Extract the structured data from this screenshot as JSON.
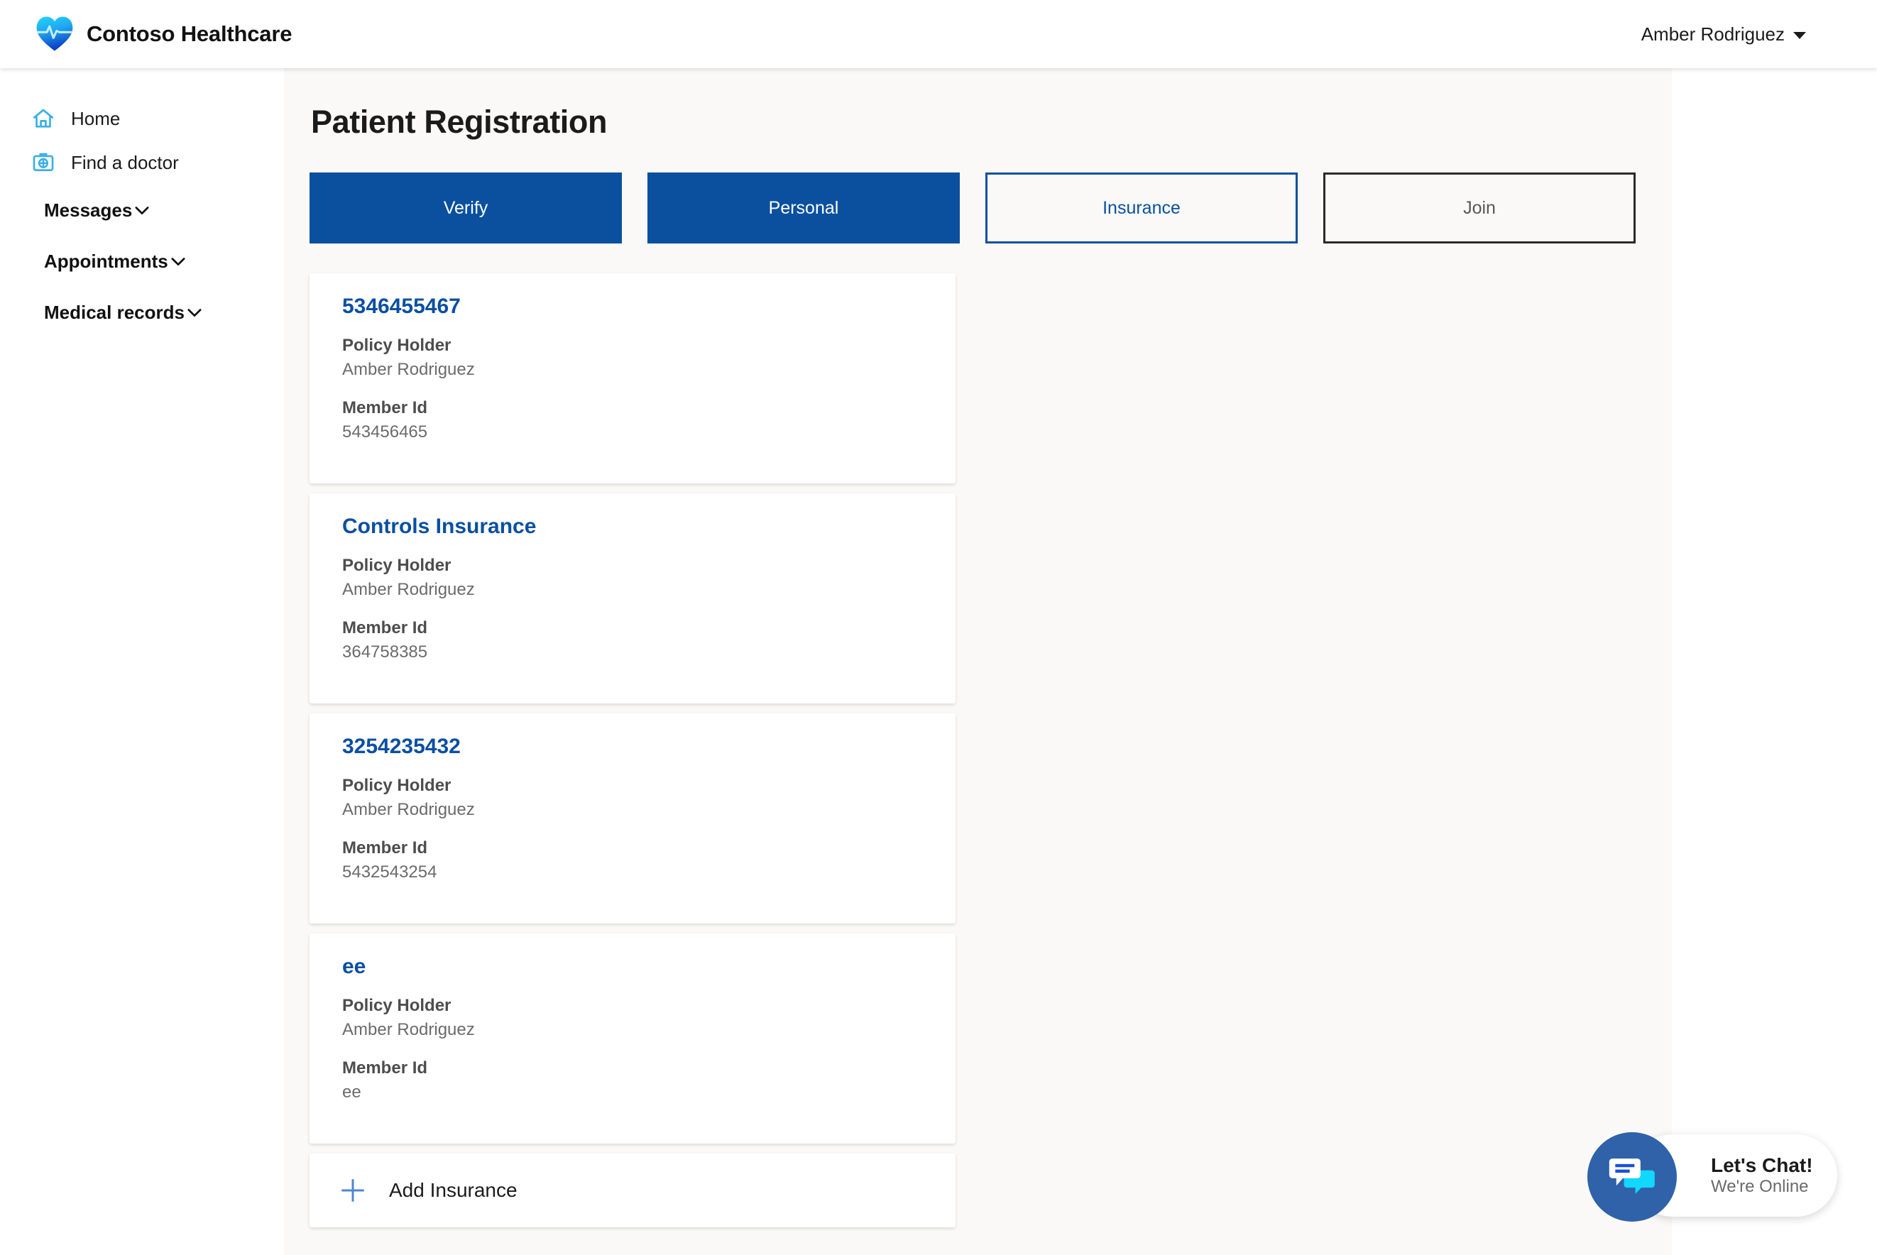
{
  "header": {
    "brand_name": "Contoso Healthcare",
    "logo_icon": "heart-pulse-logo",
    "account_name": "Amber Rodriguez",
    "account_caret_icon": "caret-down-icon"
  },
  "sidebar": {
    "links": [
      {
        "label": "Home",
        "icon": "home-icon"
      },
      {
        "label": "Find a doctor",
        "icon": "first-aid-kit-icon"
      }
    ],
    "sections": [
      {
        "label": "Messages",
        "icon": "chevron-down-icon"
      },
      {
        "label": "Appointments",
        "icon": "chevron-down-icon"
      },
      {
        "label": "Medical records",
        "icon": "chevron-down-icon"
      }
    ]
  },
  "main": {
    "page_title": "Patient Registration",
    "steps": [
      {
        "label": "Verify",
        "state": "filled"
      },
      {
        "label": "Personal",
        "state": "filled"
      },
      {
        "label": "Insurance",
        "state": "outlined"
      },
      {
        "label": "Join",
        "state": "disabled"
      }
    ],
    "field_labels": {
      "policy_holder": "Policy Holder",
      "member_id": "Member Id"
    },
    "insurance_cards": [
      {
        "title": "5346455467",
        "policy_holder_label": "Policy Holder",
        "policy_holder": "Amber Rodriguez",
        "member_id_label": "Member Id",
        "member_id": "543456465"
      },
      {
        "title": "Controls Insurance",
        "policy_holder_label": "Policy Holder",
        "policy_holder": "Amber Rodriguez",
        "member_id_label": "Member Id",
        "member_id": "364758385"
      },
      {
        "title": "3254235432",
        "policy_holder_label": "Policy Holder",
        "policy_holder": "Amber Rodriguez",
        "member_id_label": "Member Id",
        "member_id": "5432543254"
      },
      {
        "title": "ee",
        "policy_holder_label": "Policy Holder",
        "policy_holder": "Amber Rodriguez",
        "member_id_label": "Member Id",
        "member_id": "ee"
      }
    ],
    "add_insurance": {
      "label": "Add Insurance",
      "icon": "plus-icon"
    }
  },
  "chat_widget": {
    "title": "Let's Chat!",
    "status": "We're Online",
    "icon": "chat-bubbles-icon"
  },
  "colors": {
    "primary_blue": "#0a509f",
    "link_blue": "#0b4fa2",
    "icon_blue": "#3aafe8",
    "chat_blue": "#2f62a8",
    "canvas": "#faf9f8",
    "disabled_border": "#2a2a2a"
  }
}
